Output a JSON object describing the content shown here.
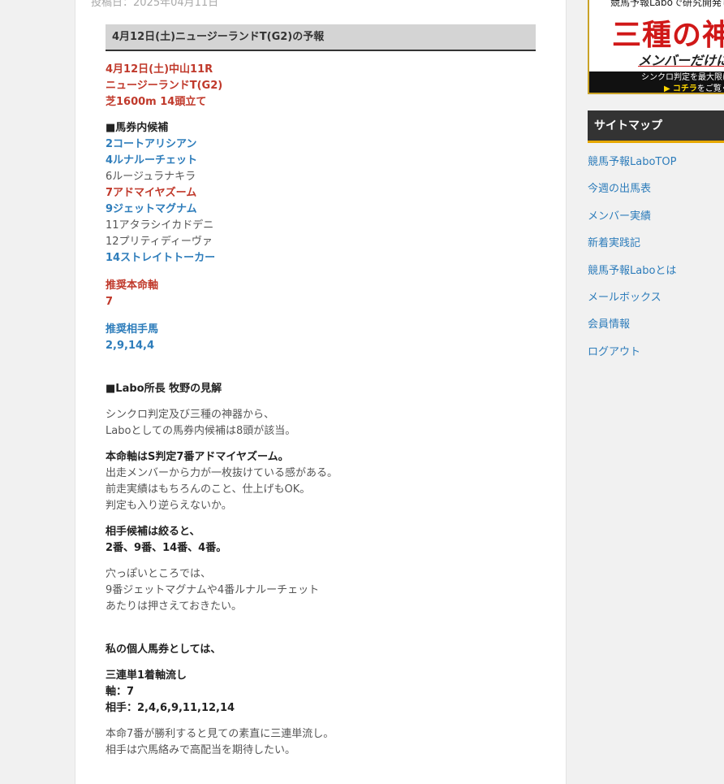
{
  "post": {
    "date": "投稿日：2025年04月11日",
    "title": "4月12日(土)ニュージーランドT(G2)の予報",
    "race": [
      "4月12日(土)中山11R",
      "ニュージーランドT(G2)",
      "芝1600m 14頭立て"
    ],
    "candidates_heading": "■馬券内候補",
    "candidates": [
      {
        "text": "2コートアリシアン",
        "style": "blue"
      },
      {
        "text": "4ルナルーチェット",
        "style": "blue"
      },
      {
        "text": "6ルージュラナキラ",
        "style": "normal"
      },
      {
        "text": "7アドマイヤズーム",
        "style": "red"
      },
      {
        "text": "9ジェットマグナム",
        "style": "blue"
      },
      {
        "text": "11アタラシイカドデニ",
        "style": "normal"
      },
      {
        "text": "12プリティディーヴァ",
        "style": "normal"
      },
      {
        "text": "14ストレイトトーカー",
        "style": "blue"
      }
    ],
    "main_axis_label": "推奨本命軸",
    "main_axis_value": "7",
    "partner_label": "推奨相手馬",
    "partner_value": "2,9,14,4",
    "opinion_heading": "■Labo所長 牧野の見解",
    "para1": [
      "シンクロ判定及び三種の神器から、",
      "Laboとしての馬券内候補は8頭が該当。"
    ],
    "para2_bold": "本命軸はS判定7番アドマイヤズーム。",
    "para2": [
      "出走メンバーから力が一枚抜けている感がある。",
      "前走実績はもちろんのこと、仕上げもOK。",
      "判定も入り逆らえないか。"
    ],
    "para3_bold": [
      "相手候補は絞ると、",
      "2番、9番、14番、4番。"
    ],
    "para4": [
      "穴っぽいところでは、",
      "9番ジェットマグナムや4番ルナルーチェット",
      "あたりは押さえておきたい。"
    ],
    "personal_heading": "私の個人馬券としては、",
    "ticket": [
      "三連単1着軸流し",
      "軸：7",
      "相手：2,4,6,9,11,12,14"
    ],
    "para5": [
      "本命7番が勝利すると見ての素直に三連単流し。",
      "相手は穴馬絡みで高配当を期待したい。"
    ]
  },
  "sidebar": {
    "banner": {
      "top_text": "競馬予報Laboで研究開発し",
      "main_text": "三種の神",
      "sub_text": "メンバーだけに",
      "bottom_text1": "シンクロ判定を最大限に",
      "bottom_text2_highlight": "コチラ",
      "bottom_text2": "をご覧く"
    },
    "sitemap_title": "サイトマップ",
    "sitemap_items": [
      "競馬予報LaboTOP",
      "今週の出馬表",
      "メンバー実績",
      "新着実践記",
      "競馬予報Laboとは",
      "メールボックス",
      "会員情報",
      "ログアウト"
    ]
  },
  "colors": {
    "red": "#c0392b",
    "blue": "#2e7dbb",
    "accent": "#e6a700"
  }
}
